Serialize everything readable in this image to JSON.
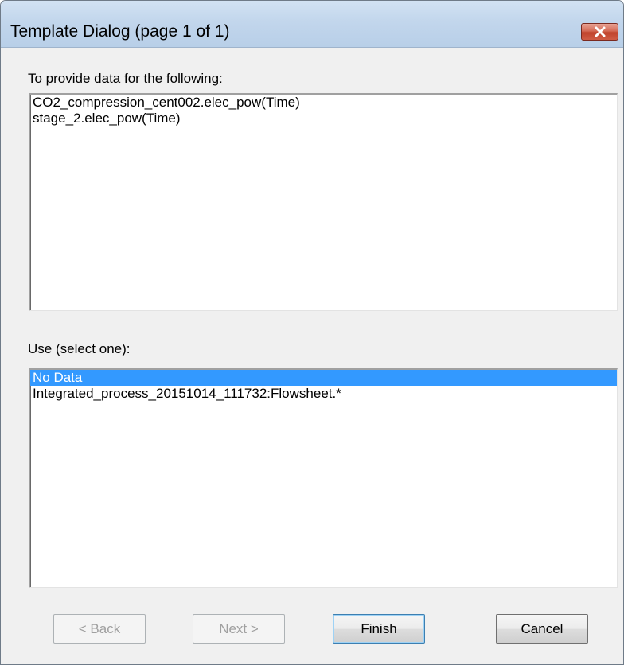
{
  "window": {
    "title": "Template Dialog (page 1 of 1)"
  },
  "provide": {
    "label": "To provide data for the following:",
    "items": [
      "CO2_compression_cent002.elec_pow(Time)",
      "stage_2.elec_pow(Time)"
    ]
  },
  "use": {
    "label": "Use (select one):",
    "items": [
      "No Data",
      "Integrated_process_20151014_111732:Flowsheet.*"
    ],
    "selected_index": 0
  },
  "buttons": {
    "back": "< Back",
    "next": "Next >",
    "finish": "Finish",
    "cancel": "Cancel"
  },
  "colors": {
    "selection": "#3399ff",
    "close_button": "#c0432c"
  },
  "icons": {
    "close": "close-icon"
  }
}
